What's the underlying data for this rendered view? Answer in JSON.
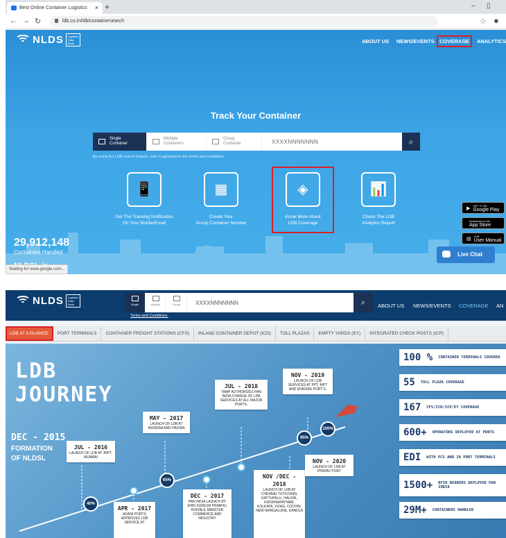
{
  "browser": {
    "tab_title": "Best Online Container Logistics",
    "url": "ldb.co.in/ldb/containersearch",
    "status_text": "Waiting for www.google.com..."
  },
  "brand": {
    "name": "NLDS",
    "box_lines": [
      "Logistics",
      "Data",
      "Bank"
    ]
  },
  "nav": {
    "about": "ABOUT US",
    "news": "NEWS/EVENTS",
    "coverage": "COVERAGE",
    "analytics": "ANALYTICS",
    "analytics_cut": "AN"
  },
  "hero": {
    "title": "Track Your Container",
    "tabs": [
      {
        "line1": "Single",
        "line2": "Container"
      },
      {
        "line1": "Multiple",
        "line2": "Containers"
      },
      {
        "line1": "Group",
        "line2": "Container"
      }
    ],
    "tabs_short": [
      "Single",
      "Multiple",
      "Group"
    ],
    "placeholder": "XXXXNNNNNNN",
    "terms": "By using the LDB search feature, user is agreeing to the terms and conditions.",
    "terms_short": "Terms and Conditions."
  },
  "features": [
    {
      "line1": "Get The Tracking Notification",
      "line2": "On Your Mobile/Email"
    },
    {
      "line1": "Create Your",
      "line2": "Group Container Number"
    },
    {
      "line1": "Know More About",
      "line2": "LDB Coverage"
    },
    {
      "line1": "Check The LDB",
      "line2": "Analytics Report"
    }
  ],
  "stats_hero": {
    "count": "29,912,148",
    "label": "Containers Handled",
    "brand": "NLDSL.in"
  },
  "stores": [
    {
      "small": "GET IT ON",
      "big": "Google Play"
    },
    {
      "small": "Download on the",
      "big": "App Store"
    },
    {
      "small": "LDB",
      "big": "User Manual"
    }
  ],
  "live_chat": "Live Chat",
  "subnav": [
    "LDB AT A GLANCE",
    "PORT TERMINALS",
    "CONTAINER FREIGHT STATIONS (CFS)",
    "INLAND CONTAINER DEPOT (ICD)",
    "TOLL PLAZAS",
    "EMPTY YARDS (EY)",
    "INTEGRATED CHECK POSTS (ICP)"
  ],
  "journey": {
    "title1": "LDB",
    "title2": "JOURNEY",
    "start_date": "DEC - 2015",
    "start_label1": "FORMATION",
    "start_label2": "OF NLDSL",
    "milestones": [
      {
        "date": "JUL - 2016",
        "text": "LAUNCH OF LDB AT JNPT, MUMBAI"
      },
      {
        "date": "APR - 2017",
        "text": "ADANI PORTS APPROVES LDB SERVICE AT"
      },
      {
        "date": "MAY - 2017",
        "text": "LAUNCH OF LDB AT MUNDRA AND HAZIRA"
      },
      {
        "date": "DEC - 2017",
        "text": "PAN INDIA LAUNCH BY SHRI SURESH PRABHU, HON'BLE MINISTER COMMERCE AND INDUSTRY"
      },
      {
        "date": "JUL - 2018",
        "text": "TAMP AUTHORIZES PAN INDIA CHARGE OF LDB SERVICES AT ALL MAJOR PORTS."
      },
      {
        "date": "NOV /DEC - 2018",
        "text": "LAUNCH OF LDB AT CHENNAI TUTICORIN, KATTUPALLI, HALDIA, KRISHNAPATNAM, KOLKATA, VIZAG, COCHIN, NEW MANGALORE, KANDLA"
      },
      {
        "date": "NOV - 2019",
        "text": "LAUNCH OF LDB SERVICES AT PPT, MPT AND ENNORE PORT'S."
      },
      {
        "date": "NOV - 2020",
        "text": "LAUNCH OF LDB AT PPAPAV PORT"
      }
    ],
    "percents": [
      "40%",
      "65%",
      "95%",
      "100%"
    ]
  },
  "stats": [
    {
      "num": "100 %",
      "text": "CONTAINER TERMINALS COVERED"
    },
    {
      "num": "55",
      "text": "TOLL PLAZA COVERAGE"
    },
    {
      "num": "167",
      "text": "CFS/ICD/ICP/EY COVERAGE"
    },
    {
      "num": "600+",
      "text": "OPERATORS DEPLOYED AT PORTS"
    },
    {
      "num": "EDI",
      "text": "WITH PCS AND 20 PORT TERMINALS"
    },
    {
      "num": "1500+",
      "text": "RFID READERS DEPLOYED PAN INDIA"
    },
    {
      "num": "29M+",
      "text": "CONTAINERS HANDLED"
    }
  ],
  "colors": {
    "header_bg": "#0c3d6e",
    "hero_bg": "#3ea5e6",
    "highlight": "#d92027",
    "search_dark": "#1b3156"
  }
}
